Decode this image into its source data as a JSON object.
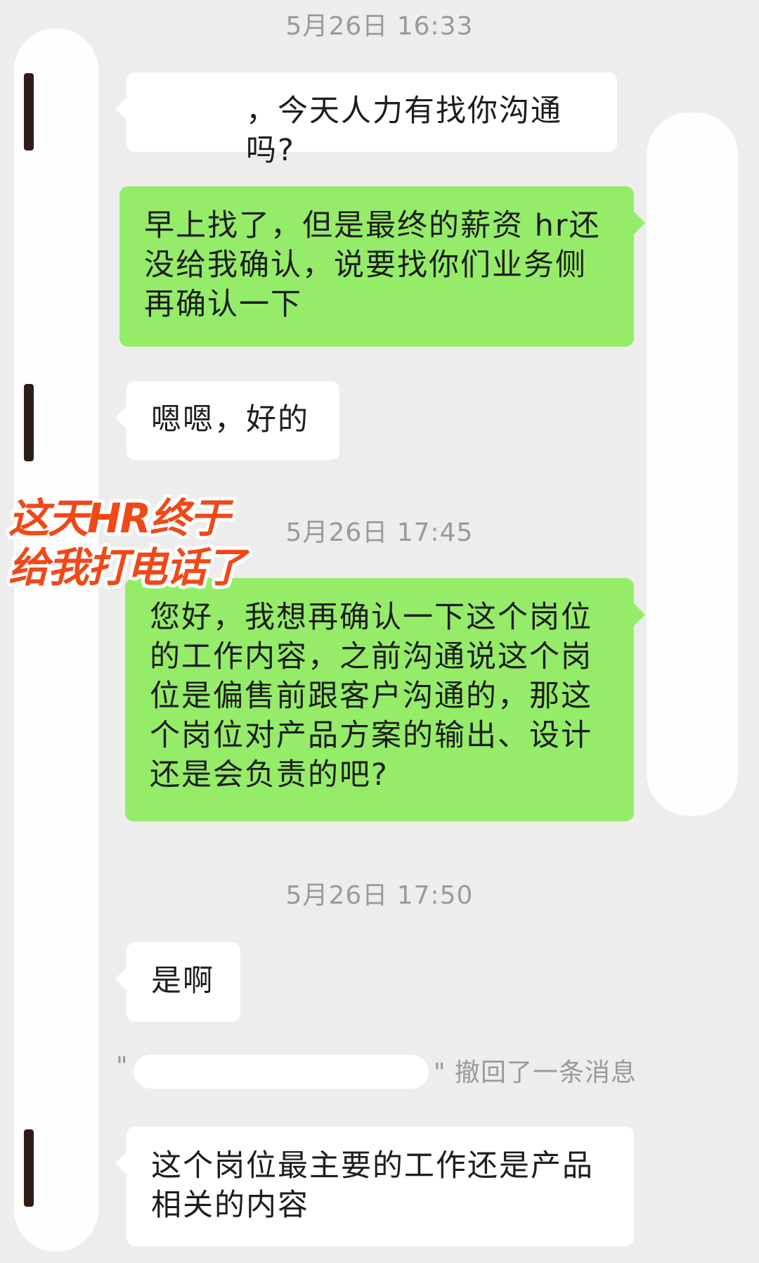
{
  "colors": {
    "background": "#ededed",
    "incoming_bubble": "#ffffff",
    "outgoing_bubble": "#95ec69",
    "timestamp_text": "#9a9a9a",
    "annotation": "#f04818"
  },
  "messages": [
    {
      "type": "timestamp",
      "text": "5月26日 16:33"
    },
    {
      "type": "incoming",
      "text": "，今天人力有找你沟通吗?"
    },
    {
      "type": "outgoing",
      "lines": [
        "早上找了，但是最终的薪资 hr还",
        "没给我确认，说要找你们业务侧",
        "再确认一下"
      ]
    },
    {
      "type": "incoming",
      "text": "嗯嗯，好的"
    },
    {
      "type": "timestamp",
      "text": "5月26日 17:45"
    },
    {
      "type": "outgoing",
      "lines": [
        "您好，我想再确认一下这个岗位",
        "的工作内容，之前沟通说这个岗",
        "位是偏售前跟客户沟通的，那这",
        "个岗位对产品方案的输出、设计",
        "还是会负责的吧?"
      ]
    },
    {
      "type": "timestamp",
      "text": "5月26日 17:50"
    },
    {
      "type": "incoming",
      "text": "是啊"
    },
    {
      "type": "recall",
      "text": "\" 撤回了一条消息"
    },
    {
      "type": "incoming",
      "lines": [
        "这个岗位最主要的工作还是产品",
        "相关的内容"
      ]
    }
  ],
  "annotation": {
    "lines": [
      "这天HR终于",
      "给我打电话了"
    ]
  }
}
